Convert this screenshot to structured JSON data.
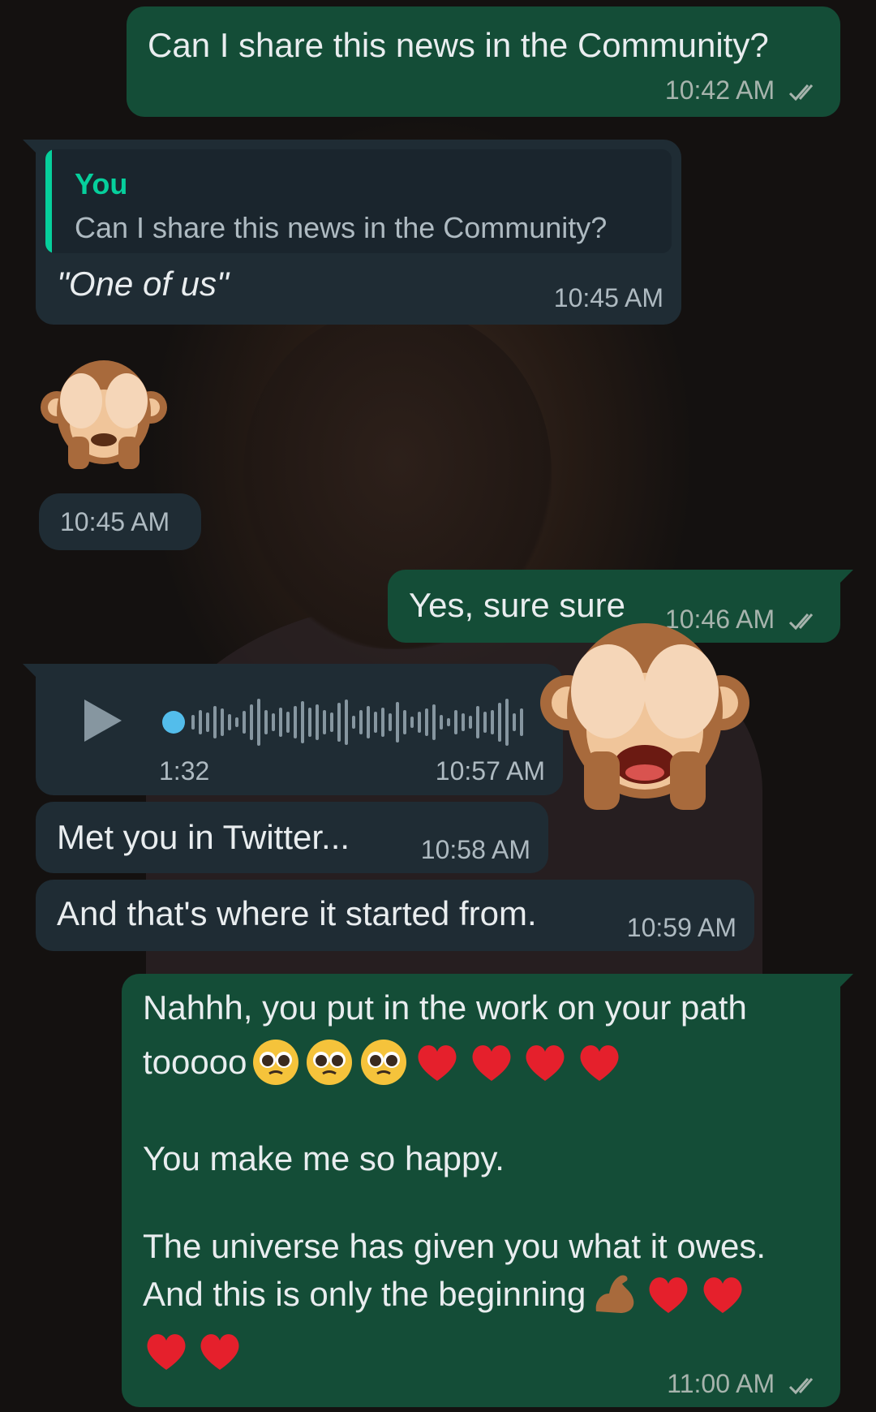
{
  "messages": [
    {
      "id": "m1",
      "direction": "outgoing",
      "text": "Can I share this news in the Community?",
      "time": "10:42 AM",
      "status": "read"
    },
    {
      "id": "m2",
      "direction": "incoming",
      "reply_to": {
        "author": "You",
        "text": "Can I share this news in the Community?"
      },
      "text": "\"One of us\"",
      "time": "10:45 AM"
    },
    {
      "id": "m3",
      "direction": "incoming",
      "sticker": "see-no-evil-monkey-icon",
      "time": "10:45 AM"
    },
    {
      "id": "m4",
      "direction": "outgoing",
      "text": "Yes, sure sure",
      "time": "10:46 AM",
      "status": "read"
    },
    {
      "id": "m5",
      "direction": "incoming",
      "voice_note": {
        "duration": "1:32",
        "progress": 0
      },
      "time": "10:57 AM"
    },
    {
      "id": "m5b",
      "direction": "incoming",
      "sticker": "see-no-evil-monkey-icon"
    },
    {
      "id": "m6",
      "direction": "incoming",
      "text": "Met you in Twitter...",
      "time": "10:58 AM"
    },
    {
      "id": "m7",
      "direction": "incoming",
      "text": "And that's where it started from.",
      "time": "10:59 AM"
    },
    {
      "id": "m8",
      "direction": "outgoing",
      "line1": "Nahhh, you put in the work on your path",
      "line2": "tooooo",
      "line3": "You make me so happy.",
      "line4": "The universe has given you what it owes.",
      "line5": "And this is only the beginning",
      "time": "11:00 AM",
      "status": "read"
    }
  ],
  "colors": {
    "outgoing_bubble": "#144d37",
    "incoming_bubble": "#1f2c34",
    "quote_accent": "#06cf9c",
    "voice_dot": "#53bdeb",
    "text": "#e9edef"
  }
}
